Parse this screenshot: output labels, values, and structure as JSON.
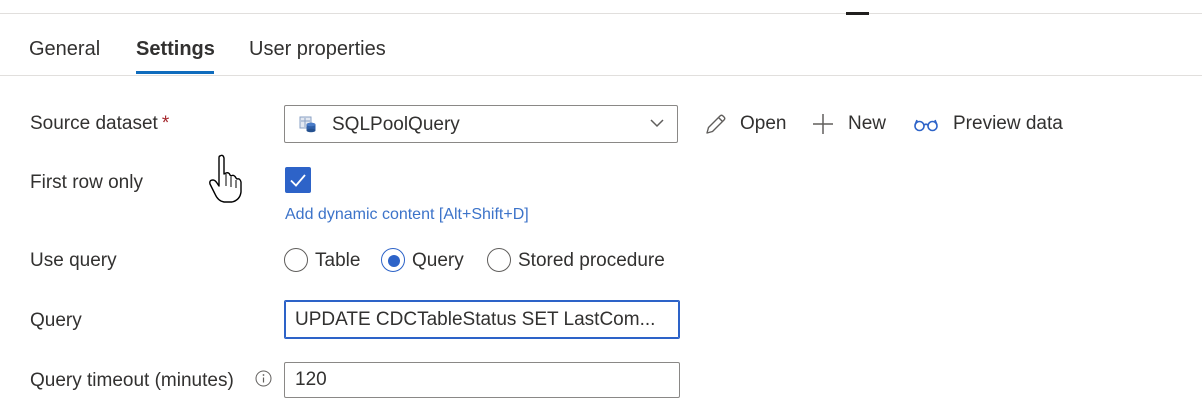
{
  "tabs": [
    {
      "label": "General",
      "active": false
    },
    {
      "label": "Settings",
      "active": true
    },
    {
      "label": "User properties",
      "active": false
    }
  ],
  "form": {
    "source_dataset": {
      "label": "Source dataset",
      "required_marker": "*",
      "value": "SQLPoolQuery"
    },
    "actions": {
      "open": "Open",
      "new": "New",
      "preview": "Preview data"
    },
    "first_row_only": {
      "label": "First row only",
      "checked": true,
      "dynamic_link": "Add dynamic content [Alt+Shift+D]"
    },
    "use_query": {
      "label": "Use query",
      "options": [
        {
          "label": "Table",
          "selected": false
        },
        {
          "label": "Query",
          "selected": true
        },
        {
          "label": "Stored procedure",
          "selected": false
        }
      ]
    },
    "query": {
      "label": "Query",
      "value": "UPDATE CDCTableStatus SET LastCom..."
    },
    "query_timeout": {
      "label": "Query timeout (minutes)",
      "value": "120"
    }
  },
  "icons": {
    "dataset": "sql-dataset-icon",
    "open": "pencil-icon",
    "new": "plus-icon",
    "preview": "glasses-icon",
    "info": "info-icon",
    "cursor": "hand-pointer-cursor"
  },
  "colors": {
    "accent": "#2d63c8",
    "link": "#3c73c9",
    "required": "#a4262c",
    "text": "#323130",
    "border": "#8a8886"
  }
}
